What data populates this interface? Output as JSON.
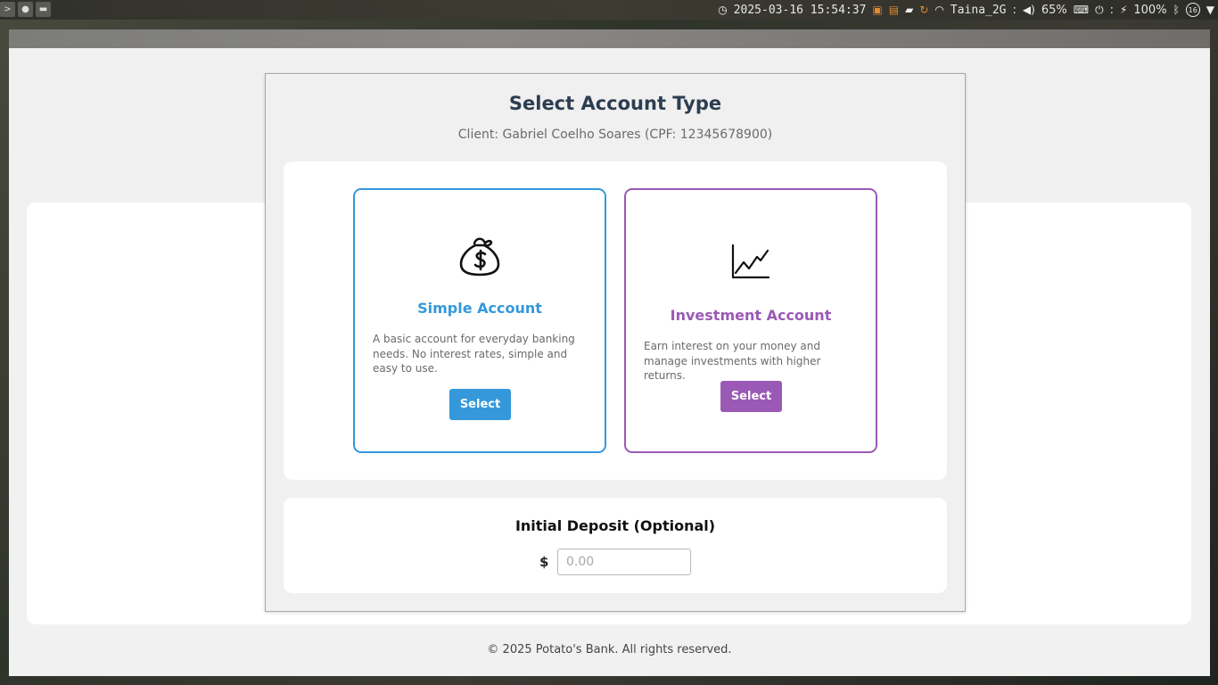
{
  "system_bar": {
    "datetime": "2025-03-16 15:54:37",
    "wifi_name": "Taina_2G",
    "separator": ":",
    "volume": "65%",
    "battery": "100%",
    "notification_count": "16",
    "icons": [
      "clock-icon",
      "terminal-icon",
      "calendar-icon",
      "folder-icon",
      "update-icon",
      "wifi-icon",
      "volume-icon",
      "keyboard-icon",
      "power-icon",
      "charging-icon",
      "bluetooth-icon",
      "network-icon"
    ]
  },
  "modal": {
    "title": "Select Account Type",
    "subtitle": "Client: Gabriel Coelho Soares (CPF: 12345678900)",
    "account_types": [
      {
        "name": "Simple Account",
        "description": "A basic account for everyday banking needs. No interest rates, simple and easy to use.",
        "button_label": "Select",
        "icon": "money-bag-icon",
        "color": "#3498db"
      },
      {
        "name": "Investment Account",
        "description": "Earn interest on your money and manage investments with higher returns.",
        "button_label": "Select",
        "icon": "line-chart-icon",
        "color": "#9b59b6"
      }
    ],
    "deposit": {
      "title": "Initial Deposit (Optional)",
      "currency_symbol": "$",
      "placeholder": "0.00",
      "value": ""
    }
  },
  "footer": {
    "text": "© 2025 Potato's Bank. All rights reserved."
  }
}
